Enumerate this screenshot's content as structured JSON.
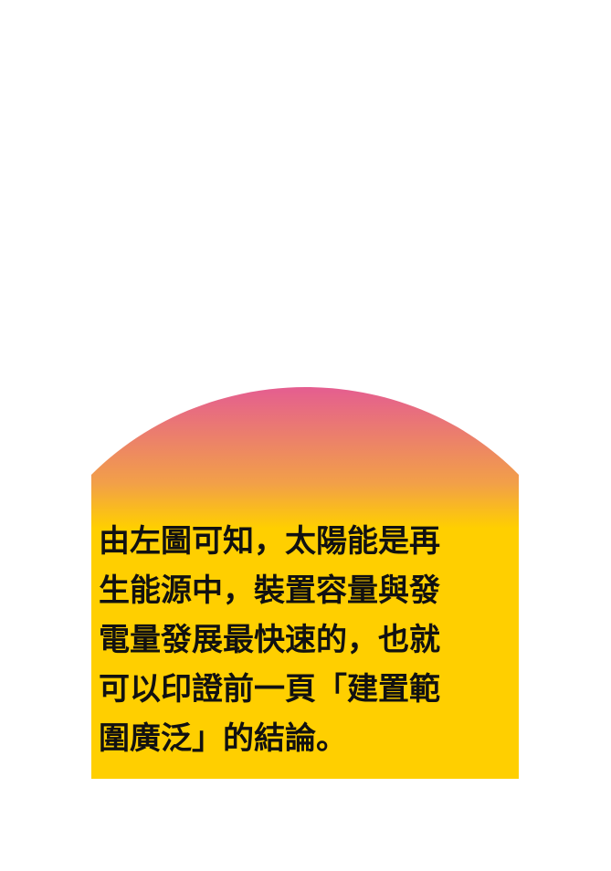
{
  "card": {
    "colors": {
      "dome_top": "#E45B93",
      "dome_mid": "#F2A048",
      "body": "#FFCF00",
      "text": "#111111",
      "background": "#FFFFFF"
    },
    "caption_lines": [
      "由左圖可知，太陽能是再",
      "生能源中，裝置容量與發",
      "電量發展最快速的，也就",
      "可以印證前一頁「建置範",
      "圍廣泛」的結論。"
    ]
  }
}
